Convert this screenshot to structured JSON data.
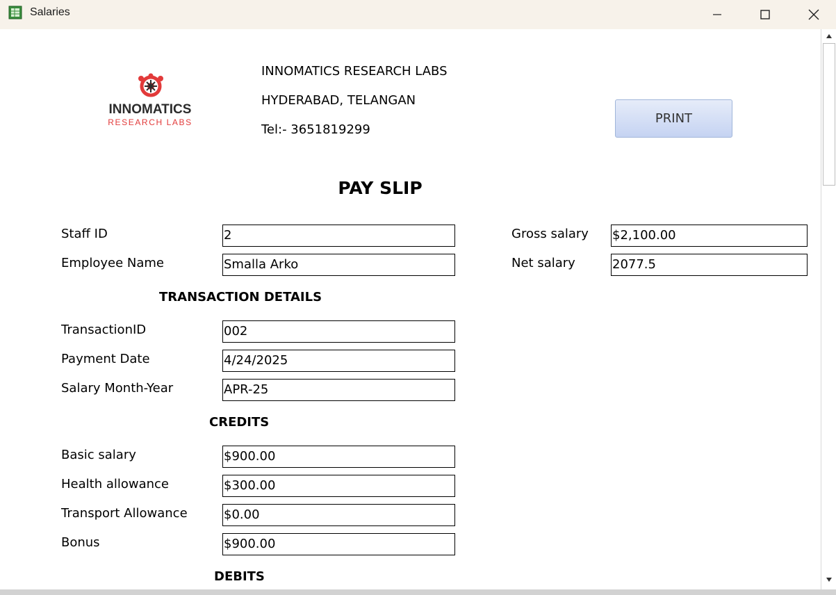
{
  "window": {
    "title": "Salaries",
    "icon": "spreadsheet-app-icon"
  },
  "logo": {
    "brand": "INNOMATICS",
    "sub": "RESEARCH LABS"
  },
  "company": {
    "name": "INNOMATICS RESEARCH LABS",
    "address": "HYDERABAD, TELANGAN",
    "phone": "Tel:- 3651819299"
  },
  "buttons": {
    "print": "PRINT"
  },
  "payslip": {
    "title": "PAY SLIP",
    "staff_id": {
      "label": "Staff ID",
      "value": "2"
    },
    "employee_name": {
      "label": "Employee Name",
      "value": "Smalla Arko"
    },
    "gross_salary": {
      "label": "Gross salary",
      "value": "$2,100.00"
    },
    "net_salary": {
      "label": "Net salary",
      "value": "2077.5"
    }
  },
  "transaction": {
    "heading": "TRANSACTION DETAILS",
    "transaction_id": {
      "label": "TransactionID",
      "value": "002"
    },
    "payment_date": {
      "label": "Payment Date",
      "value": "4/24/2025"
    },
    "salary_month_year": {
      "label": "Salary Month-Year",
      "value": "APR-25"
    }
  },
  "credits": {
    "heading": "CREDITS",
    "basic_salary": {
      "label": "Basic salary",
      "value": "$900.00"
    },
    "health_allowance": {
      "label": "Health allowance",
      "value": "$300.00"
    },
    "transport_allowance": {
      "label": "Transport Allowance",
      "value": "$0.00"
    },
    "bonus": {
      "label": "Bonus",
      "value": "$900.00"
    }
  },
  "debits": {
    "heading": "DEBITS"
  },
  "colors": {
    "titlebar": "#f7f2ea",
    "logo_red": "#e23a3a",
    "button_top": "#e6ecf9",
    "button_bottom": "#c5d3f2"
  }
}
